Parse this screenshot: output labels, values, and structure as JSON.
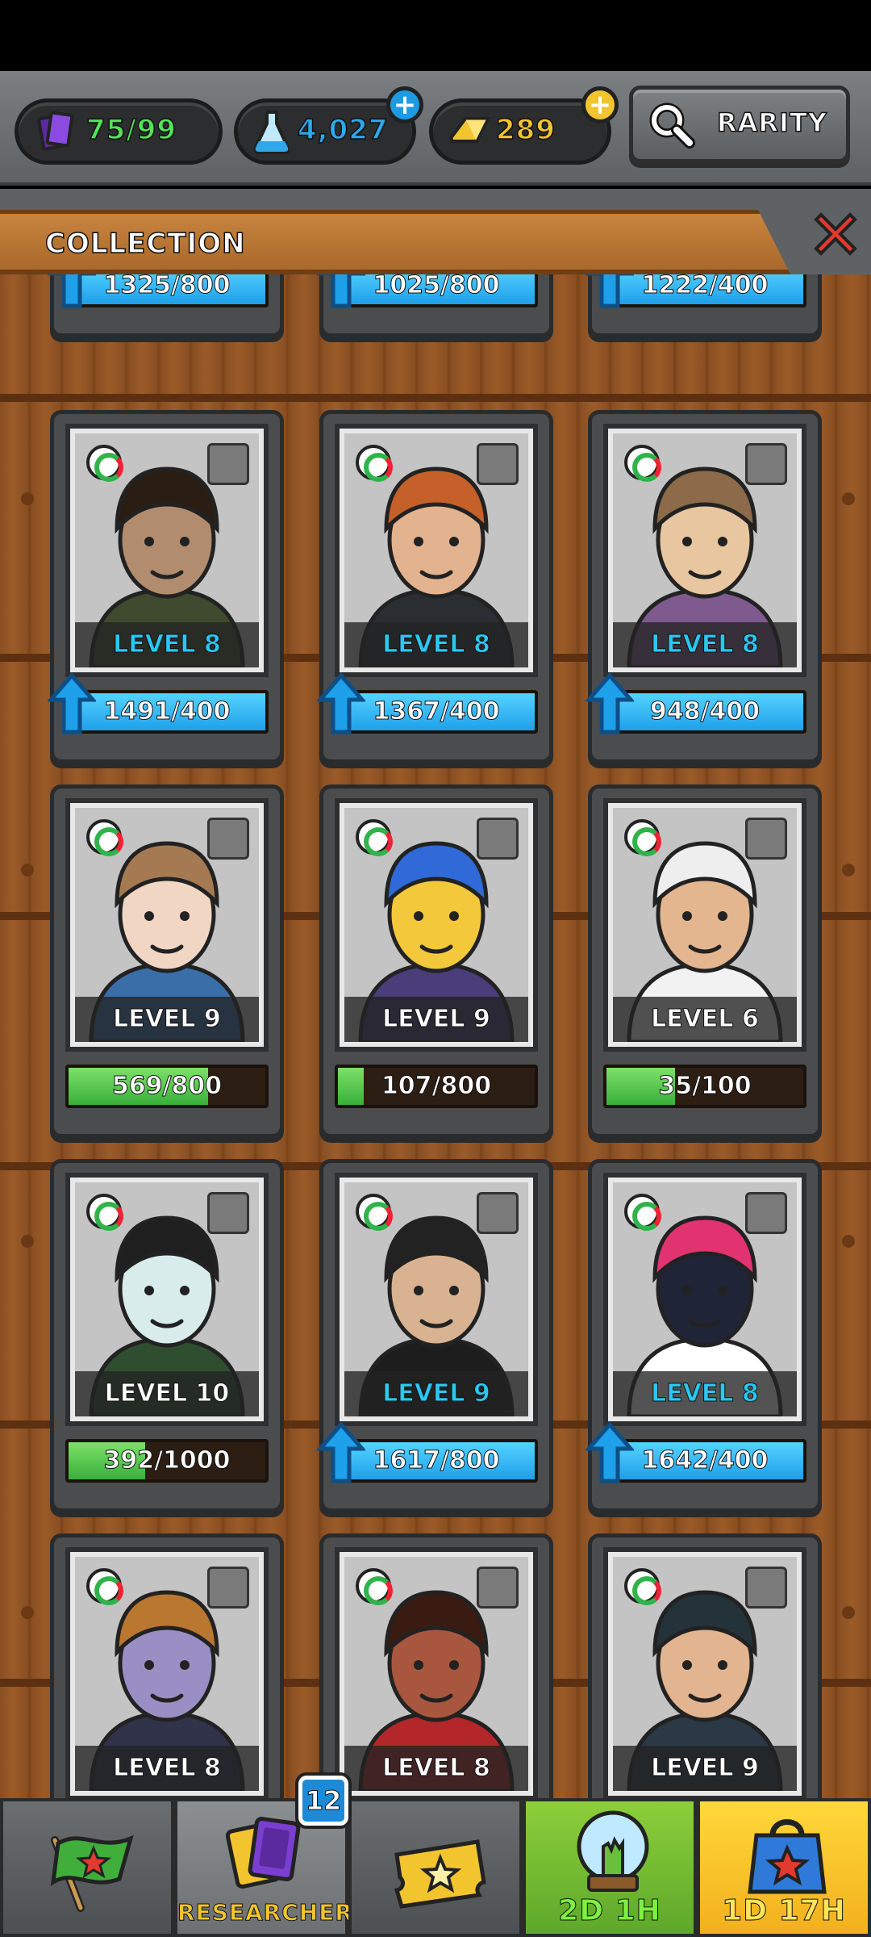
{
  "resources": {
    "cards": "75/99",
    "flasks": "4,027",
    "gold": "289"
  },
  "search": {
    "label": "RARITY"
  },
  "collection": {
    "title": "COLLECTION"
  },
  "partial_row": [
    {
      "progress": "1325/800"
    },
    {
      "progress": "1025/800"
    },
    {
      "progress": "1222/400"
    }
  ],
  "cards": [
    {
      "level": "LEVEL 8",
      "progress": "1491/400",
      "fill": 1.0,
      "upgrade": true,
      "skin": "#b28c6e",
      "hair": "#2a1d14",
      "shirt": "#3f4a2e"
    },
    {
      "level": "LEVEL 8",
      "progress": "1367/400",
      "fill": 1.0,
      "upgrade": true,
      "skin": "#e3b38f",
      "hair": "#c5602a",
      "shirt": "#2a2e33"
    },
    {
      "level": "LEVEL 8",
      "progress": "948/400",
      "fill": 1.0,
      "upgrade": true,
      "skin": "#e7c6a0",
      "hair": "#8c6a4a",
      "shirt": "#7e5a8e"
    },
    {
      "level": "LEVEL 9",
      "progress": "569/800",
      "fill": 0.71,
      "upgrade": false,
      "skin": "#f1d6c4",
      "hair": "#a57a52",
      "shirt": "#3a6ea8"
    },
    {
      "level": "LEVEL 9",
      "progress": "107/800",
      "fill": 0.13,
      "upgrade": false,
      "skin": "#f3c83b",
      "hair": "#2f6ad8",
      "shirt": "#4a3e7a"
    },
    {
      "level": "LEVEL 6",
      "progress": "35/100",
      "fill": 0.35,
      "upgrade": false,
      "skin": "#e4b690",
      "hair": "#eeeeee",
      "shirt": "#f2f2f2"
    },
    {
      "level": "LEVEL 10",
      "progress": "392/1000",
      "fill": 0.39,
      "upgrade": false,
      "skin": "#d8ecec",
      "hair": "#1f1f1f",
      "shirt": "#2f4d2f"
    },
    {
      "level": "LEVEL 9",
      "progress": "1617/800",
      "fill": 1.0,
      "upgrade": true,
      "skin": "#d9b291",
      "hair": "#222222",
      "shirt": "#1d1d1d"
    },
    {
      "level": "LEVEL 8",
      "progress": "1642/400",
      "fill": 1.0,
      "upgrade": true,
      "skin": "#1f2536",
      "hair": "#e0336f",
      "shirt": "#ffffff"
    },
    {
      "level": "LEVEL 8",
      "skin": "#9a8fc4",
      "hair": "#b9772f",
      "shirt": "#30334a"
    },
    {
      "level": "LEVEL 8",
      "skin": "#a8563e",
      "hair": "#3a1b12",
      "shirt": "#b3262a"
    },
    {
      "level": "LEVEL 9",
      "skin": "#e2b48f",
      "hair": "#24323a",
      "shirt": "#2b3946"
    }
  ],
  "nav": {
    "researchers_label": "RESEARCHERS",
    "researchers_badge": "12",
    "timer1": "2D 1H",
    "timer2": "1D 17H"
  },
  "colors": {
    "accent_cyan": "#29c8f2",
    "progress_green": "#38b03a",
    "upgrade_blue": "#1ea0ea",
    "gold": "#f2c42e"
  }
}
